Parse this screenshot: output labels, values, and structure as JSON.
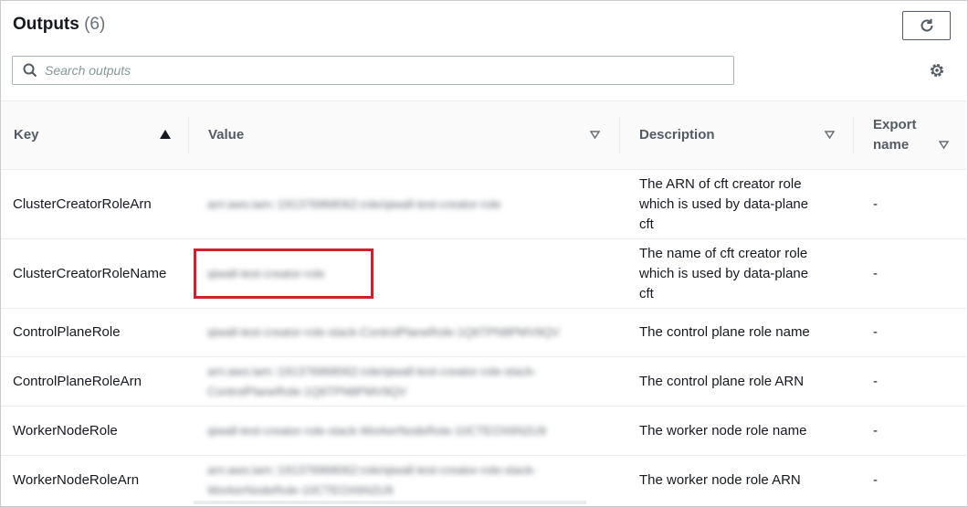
{
  "header": {
    "title": "Outputs",
    "count": "(6)"
  },
  "search": {
    "placeholder": "Search outputs",
    "value": ""
  },
  "icons": {
    "refresh": "refresh-icon",
    "search": "search-icon",
    "settings": "gear-icon",
    "sort_asc": "caret-up-icon",
    "sort_none": "caret-down-outline-icon"
  },
  "table": {
    "columns": [
      {
        "label": "Key"
      },
      {
        "label": "Value"
      },
      {
        "label": "Description"
      },
      {
        "label": "Export name"
      }
    ],
    "rows": [
      {
        "key": "ClusterCreatorRoleArn",
        "value": "arn:aws:iam::191376968062:role/qiwall-test-creator-role",
        "description": "The ARN of cft creator role which is used by data-plane cft",
        "export": "-"
      },
      {
        "key": "ClusterCreatorRoleName",
        "value": "qiwall-test-creator-role",
        "description": "The name of cft creator role which is used by data-plane cft",
        "export": "-"
      },
      {
        "key": "ControlPlaneRole",
        "value": "qiwall-test-creator-role-stack-ControlPlaneRole-1Q6TPN8PMV9QV",
        "description": "The control plane role name",
        "export": "-"
      },
      {
        "key": "ControlPlaneRoleArn",
        "value": "arn:aws:iam::191376968062:role/qiwall-test-creator-role-stack-ControlPlaneRole-1Q6TPN8PMV9QV",
        "description": "The control plane role ARN",
        "export": "-"
      },
      {
        "key": "WorkerNodeRole",
        "value": "qiwall-test-creator-role-stack-WorkerNodeRole-10CTEOX6N2U9",
        "description": "The worker node role name",
        "export": "-"
      },
      {
        "key": "WorkerNodeRoleArn",
        "value": "arn:aws:iam::191376968062:role/qiwall-test-creator-role-stack-WorkerNodeRole-10CTEOX6N2U9",
        "description": "The worker node role ARN",
        "export": "-"
      }
    ]
  },
  "colors": {
    "highlight": "#d0212b",
    "header_text": "#545b64",
    "border": "#eaeded"
  }
}
